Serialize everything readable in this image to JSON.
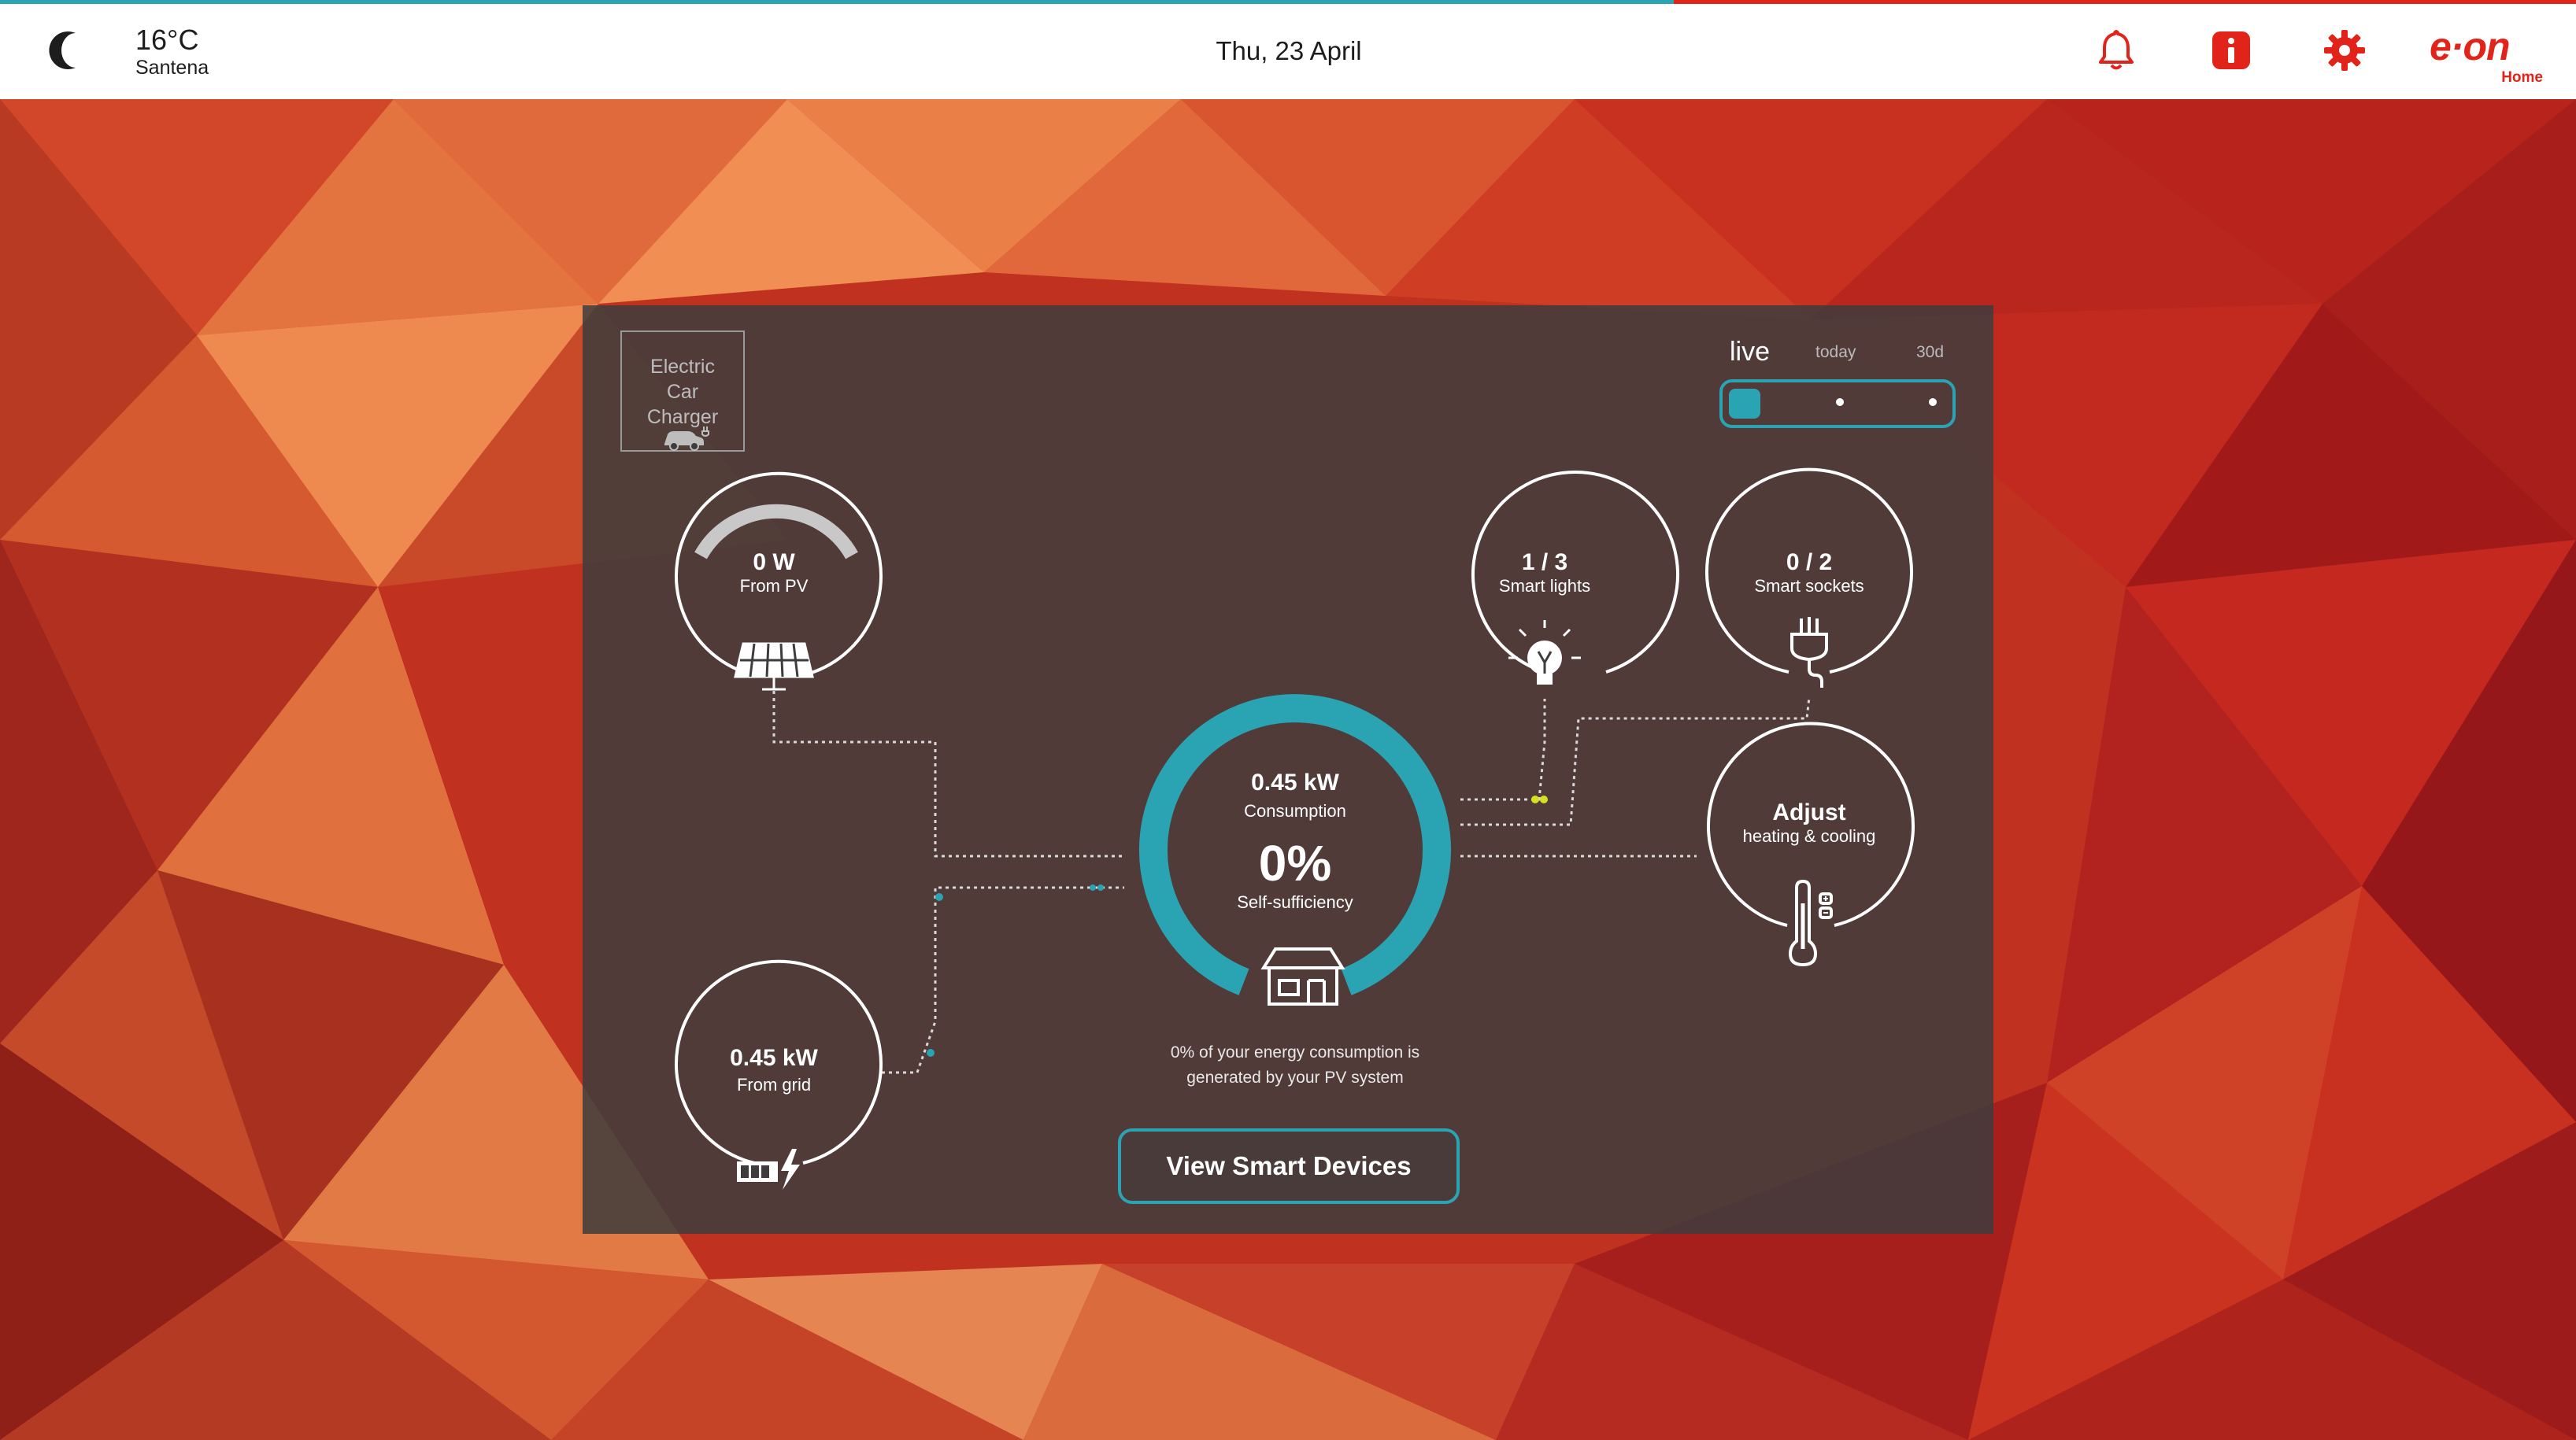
{
  "header": {
    "weather_icon": "moon-icon",
    "temperature": "16°C",
    "location": "Santena",
    "date": "Thu, 23 April",
    "icons": [
      "bell-icon",
      "info-icon",
      "gear-icon"
    ],
    "logo": {
      "text": "e·on",
      "sub": "Home"
    }
  },
  "colors": {
    "accent": "#2aa3b3",
    "brand": "#e2231a",
    "highlight": "#d4e021"
  },
  "charger": {
    "label_lines": [
      "Electric",
      "Car",
      "Charger"
    ],
    "icon": "car-charger-icon"
  },
  "time_range": {
    "options": [
      "live",
      "today",
      "30d"
    ],
    "selected": "live"
  },
  "pv": {
    "value": "0 W",
    "label": "From PV",
    "icon": "solar-panel-icon"
  },
  "grid": {
    "value": "0.45 kW",
    "label": "From grid",
    "icon": "meter-bolt-icon"
  },
  "consumption": {
    "value": "0.45 kW",
    "label": "Consumption",
    "self_sufficiency": "0%",
    "self_label": "Self-sufficiency",
    "icon": "house-icon",
    "note_line1": "0% of your energy consumption is",
    "note_line2": "generated by your PV system"
  },
  "lights": {
    "value": "1 / 3",
    "label": "Smart lights",
    "icon": "lightbulb-icon"
  },
  "sockets": {
    "value": "0 / 2",
    "label": "Smart sockets",
    "icon": "plug-icon"
  },
  "climate": {
    "title": "Adjust",
    "label": "heating & cooling",
    "icon": "thermometer-icon"
  },
  "actions": {
    "view_devices": "View Smart Devices"
  }
}
